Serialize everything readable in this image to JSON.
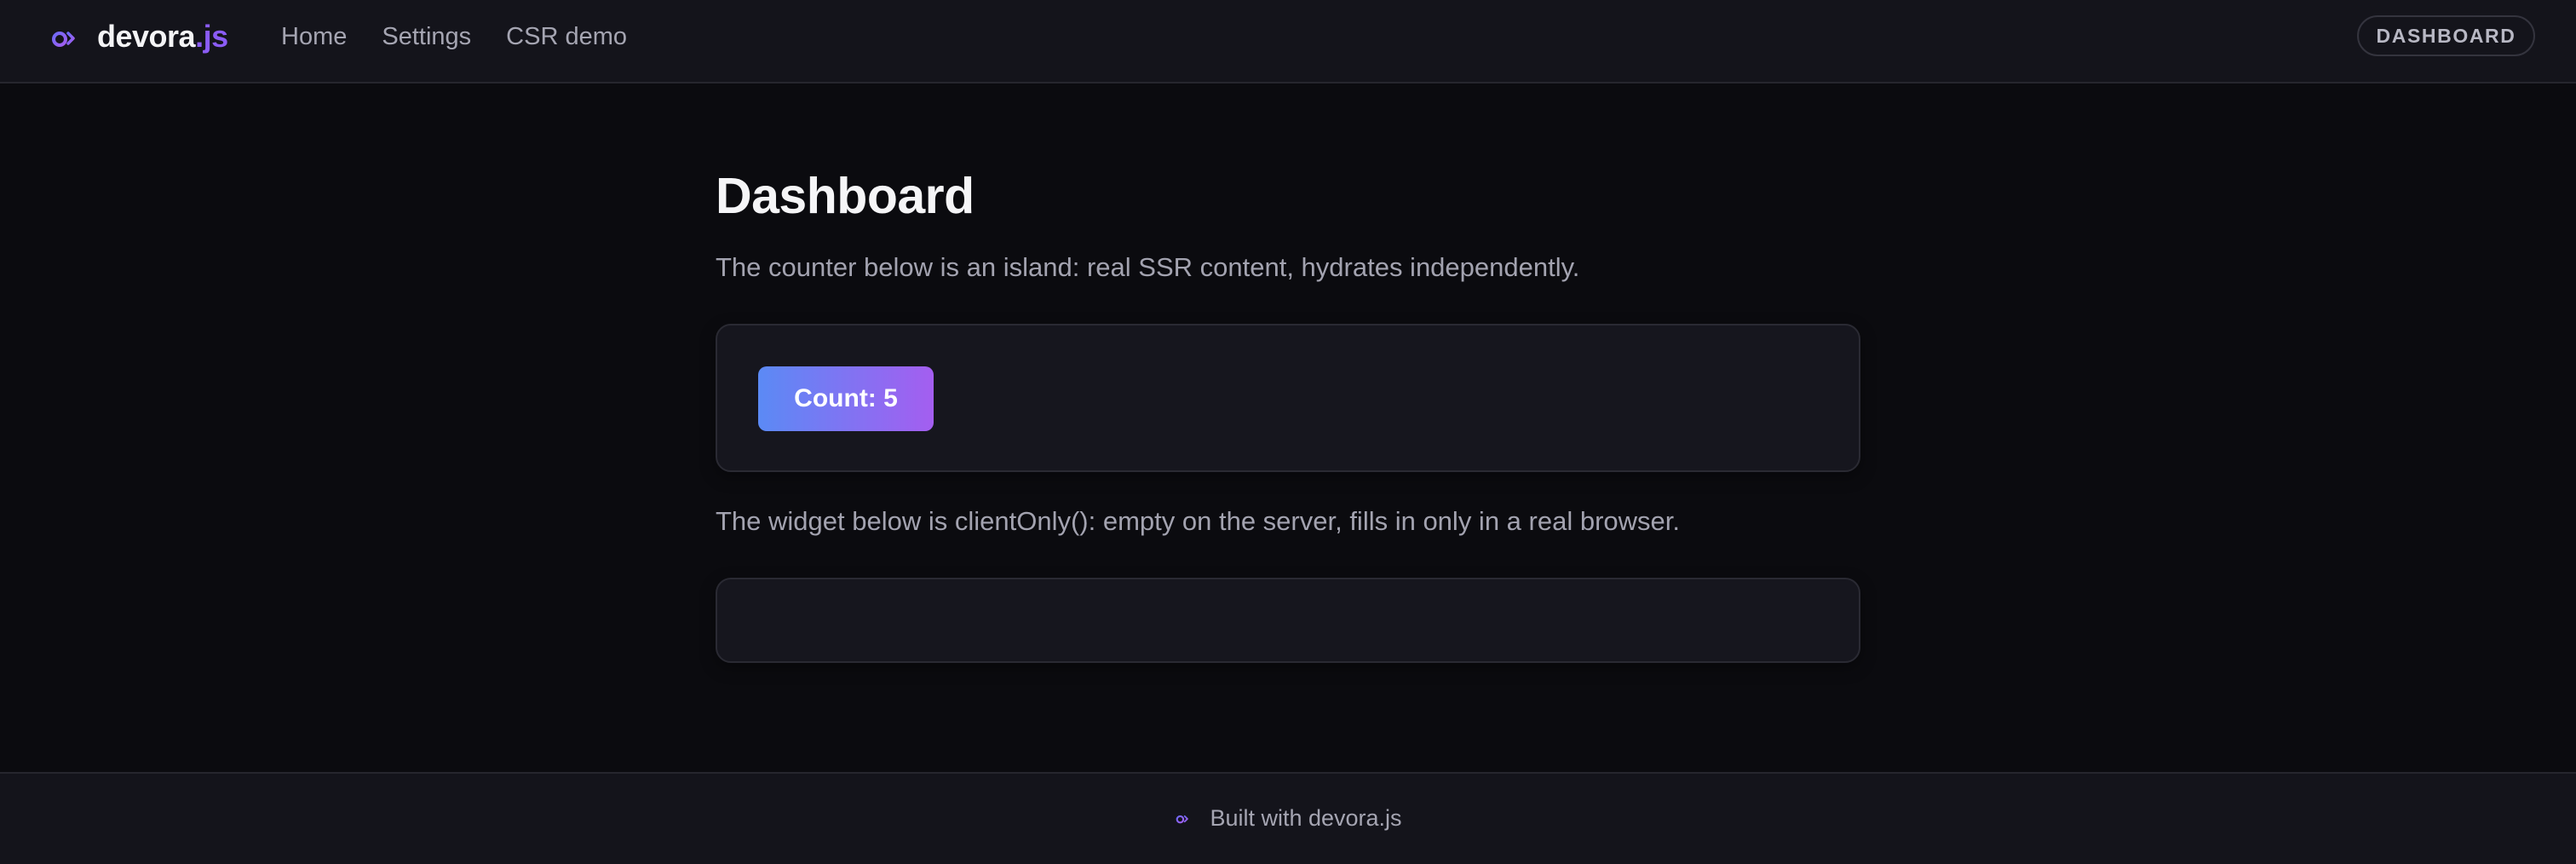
{
  "header": {
    "brand": {
      "name": "devora",
      "accent": ".js",
      "icon": "devora-logo-icon"
    },
    "nav": [
      {
        "label": "Home"
      },
      {
        "label": "Settings"
      },
      {
        "label": "CSR demo"
      }
    ],
    "route_badge": "DASHBOARD"
  },
  "main": {
    "title": "Dashboard",
    "island_description": "The counter below is an island: real SSR content, hydrates independently.",
    "counter_label": "Count: 5",
    "client_only_description": "The widget below is clientOnly(): empty on the server, fills in only in a real browser."
  },
  "footer": {
    "icon": "devora-logo-icon",
    "text": "Built with devora.js"
  },
  "colors": {
    "background": "#0b0b0f",
    "surface": "#14141b",
    "card": "#16161e",
    "accent": "#8b5cf6",
    "gradient_start": "#5b8af5",
    "gradient_end": "#a45ef0"
  }
}
